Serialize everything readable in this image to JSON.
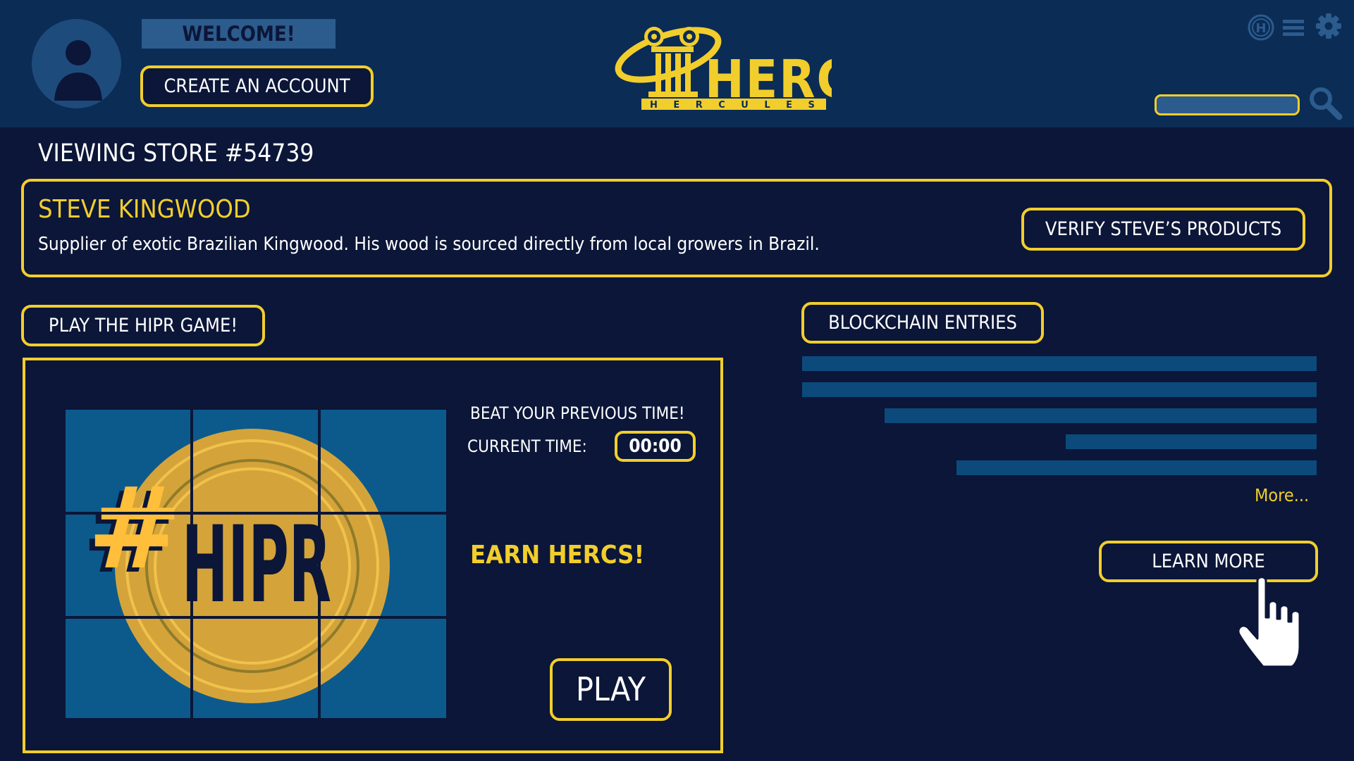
{
  "header": {
    "welcome": "WELCOME!",
    "create_account": "CREATE AN ACCOUNT",
    "logo": {
      "word": "HERC",
      "subword": "HERCULES",
      "color": "#f2ce2c"
    },
    "icons": [
      "herc-coin-icon",
      "menu-icon",
      "gear-icon",
      "search-icon"
    ],
    "search": {
      "value": "",
      "placeholder": ""
    }
  },
  "store": {
    "title": "VIEWING STORE #54739",
    "supplier_name": "STEVE KINGWOOD",
    "description": "Supplier of exotic Brazilian Kingwood. His wood is sourced directly from local growers in Brazil.",
    "verify_button": "VERIFY STEVE’S PRODUCTS"
  },
  "game": {
    "tab_label": "PLAY THE HIPR GAME!",
    "art": {
      "hash": "#",
      "word": "HIPR"
    },
    "beat_label": "BEAT YOUR PREVIOUS TIME!",
    "current_time_label": "CURRENT TIME:",
    "current_time": "00:00",
    "earn_label": "EARN HERCS!",
    "play_button": "PLAY"
  },
  "blockchain": {
    "tab_label": "BLOCKCHAIN ENTRIES",
    "entries": [
      {
        "length": 1.0
      },
      {
        "length": 1.0
      },
      {
        "length": 0.84
      },
      {
        "length": 0.487
      },
      {
        "length": 0.7
      }
    ],
    "more_link": "More...",
    "learn_more": "LEARN MORE"
  },
  "colors": {
    "background": "#0b1638",
    "header": "#0b2c55",
    "accent_yellow": "#f2ce2c",
    "entry_bar": "#0c4a7c",
    "coin": "#d4a43a",
    "tile": "#0c5a8c"
  }
}
